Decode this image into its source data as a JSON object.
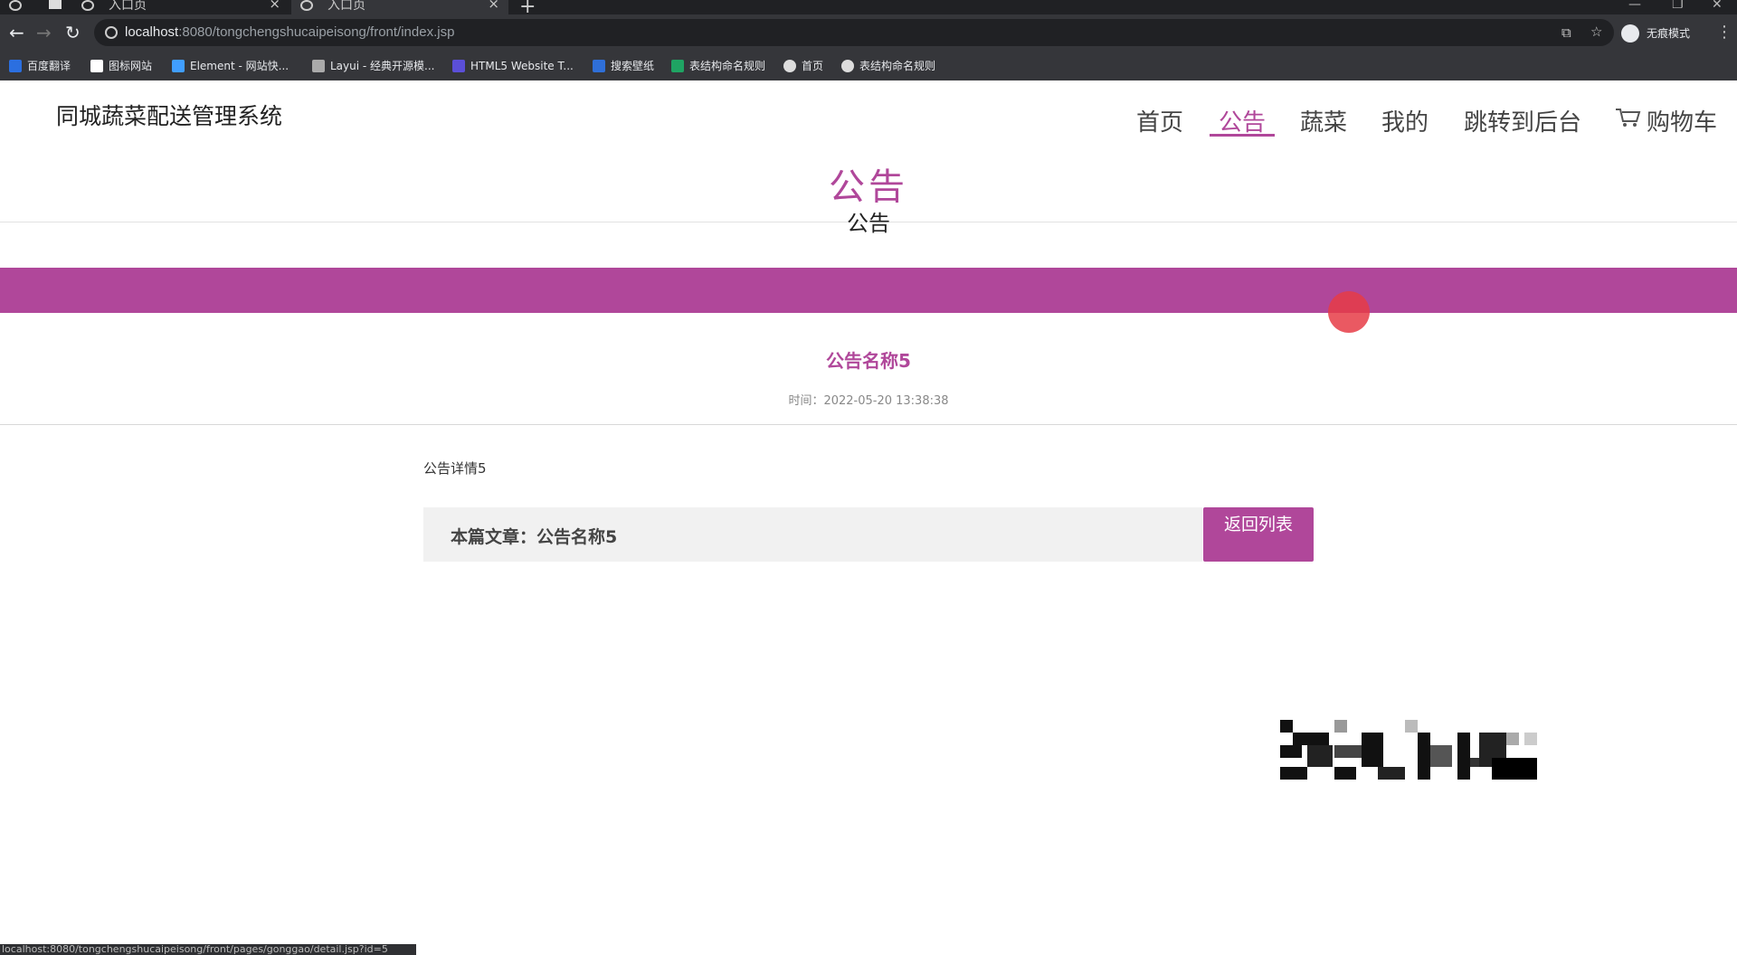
{
  "browser": {
    "tabs": [
      {
        "label": "入口页",
        "active": false
      },
      {
        "label": "入口页",
        "active": true
      }
    ],
    "url_host": "localhost",
    "url_path": ":8080/tongchengshucaipeisong/front/index.jsp",
    "incognito_label": "无痕模式",
    "bookmarks": [
      {
        "label": "百度翻译",
        "color": "#2b6fe0"
      },
      {
        "label": "图标网站",
        "color": "#ffffff"
      },
      {
        "label": "Element - 网站快...",
        "color": "#409eff"
      },
      {
        "label": "Layui - 经典开源模...",
        "color": "#aaaaaa"
      },
      {
        "label": "HTML5 Website T...",
        "color": "#5b4fd8"
      },
      {
        "label": "搜索壁纸",
        "color": "#2f6fd8"
      },
      {
        "label": "表结构命名规则",
        "color": "#1fa463"
      },
      {
        "label": "首页",
        "color": "#dddddd"
      },
      {
        "label": "表结构命名规则",
        "color": "#dddddd"
      }
    ],
    "status_url": "localhost:8080/tongchengshucaipeisong/front/pages/gonggao/detail.jsp?id=5"
  },
  "site": {
    "title": "同城蔬菜配送管理系统",
    "nav": [
      "首页",
      "公告",
      "蔬菜",
      "我的",
      "跳转到后台",
      "购物车"
    ],
    "active_nav": "公告",
    "accent_color": "#b0479a"
  },
  "header": {
    "title": "公告",
    "subtitle": "公告"
  },
  "article": {
    "title": "公告名称5",
    "time": "时间：2022-05-20 13:38:38",
    "body": "公告详情5",
    "current_label": "本篇文章：公告名称5",
    "back_button": "返回列表"
  }
}
